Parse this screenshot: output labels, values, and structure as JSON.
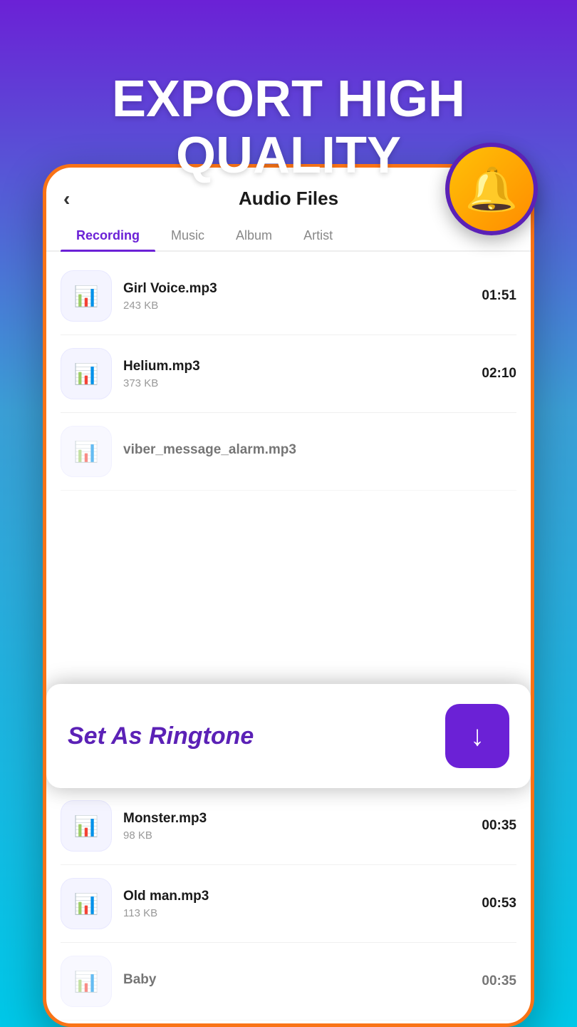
{
  "hero": {
    "title_line1": "EXPORT HIGH",
    "title_line2": "QUALITY"
  },
  "header": {
    "back_label": "‹",
    "title": "Audio Files"
  },
  "tabs": [
    {
      "id": "recording",
      "label": "Recording",
      "active": true
    },
    {
      "id": "music",
      "label": "Music",
      "active": false
    },
    {
      "id": "album",
      "label": "Album",
      "active": false
    },
    {
      "id": "artist",
      "label": "Artist",
      "active": false
    }
  ],
  "audio_files": [
    {
      "name": "Girl Voice.mp3",
      "size": "243 KB",
      "duration": "01:51"
    },
    {
      "name": "Helium.mp3",
      "size": "373 KB",
      "duration": "02:10"
    },
    {
      "name": "viber_message_alarm.mp3",
      "size": "",
      "duration": "",
      "partial": true
    },
    {
      "name": "Old man.mp3",
      "size": "113 KB",
      "duration": ""
    },
    {
      "name": "Monster.mp3",
      "size": "98 KB",
      "duration": "00:35"
    },
    {
      "name": "Old man.mp3",
      "size": "113 KB",
      "duration": "00:53"
    },
    {
      "name": "Baby",
      "size": "",
      "duration": "00:35",
      "partial_bottom": true
    }
  ],
  "banner": {
    "set_ringtone_label": "Set As Ringtone",
    "download_icon": "↓"
  },
  "colors": {
    "primary_purple": "#6B21D6",
    "active_tab": "#6B21D6",
    "orange_border": "#F97316",
    "bell_gradient_start": "#FFC107",
    "bell_gradient_end": "#FF8C00"
  }
}
